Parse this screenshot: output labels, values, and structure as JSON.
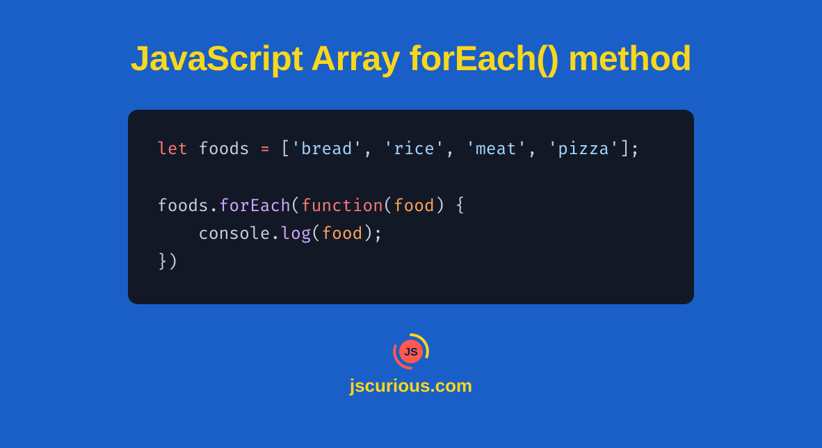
{
  "title": "JavaScript Array forEach() method",
  "code": {
    "line1": {
      "let": "let",
      "sp1": " ",
      "var": "foods",
      "sp2": " ",
      "eq": "=",
      "sp3": " ",
      "lb": "[",
      "s1": "'bread'",
      "c1": ",",
      "sp4": " ",
      "s2": "'rice'",
      "c2": ",",
      "sp5": " ",
      "s3": "'meat'",
      "c3": ",",
      "sp6": " ",
      "s4": "'pizza'",
      "rb": "]",
      "semi": ";"
    },
    "blank": " ",
    "line2": {
      "obj": "foods",
      "dot": ".",
      "method": "forEach",
      "lp": "(",
      "fn": "function",
      "lp2": "(",
      "param": "food",
      "rp2": ")",
      "sp": " ",
      "lb": "{"
    },
    "line3": {
      "indent": "    ",
      "console": "console",
      "dot": ".",
      "log": "log",
      "lp": "(",
      "arg": "food",
      "rp": ")",
      "semi": ";"
    },
    "line4": {
      "rb": "}",
      "rp": ")"
    }
  },
  "footer": {
    "logo_text": "JS",
    "site": "jscurious.com"
  },
  "colors": {
    "bg": "#1a5fc7",
    "title": "#f9d71c",
    "code_bg": "#131827"
  }
}
